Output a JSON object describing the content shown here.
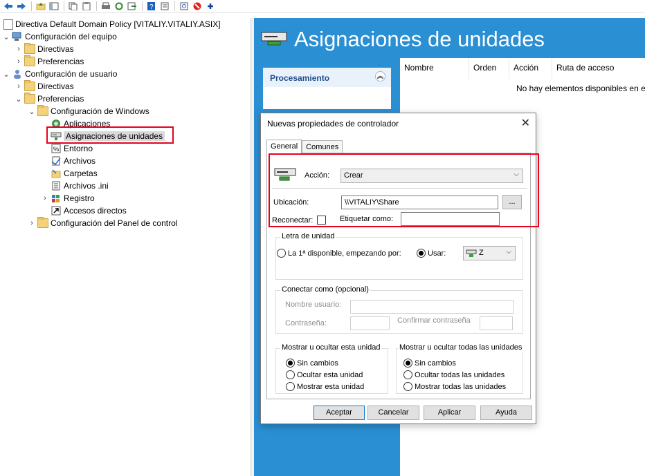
{
  "toolbar": {
    "icons": [
      "back-arrow-icon",
      "forward-arrow-icon",
      "up-folder-icon",
      "show-hide-tree-icon",
      "copy-icon",
      "paste-icon",
      "print-icon",
      "refresh-icon",
      "export-icon",
      "help-icon",
      "properties-icon",
      "stop-icon",
      "add-icon"
    ]
  },
  "tree": {
    "root": "Directiva Default Domain Policy [VITALIY.VITALIY.ASIX]",
    "computer_config": "Configuración del equipo",
    "c_policies": "Directivas",
    "c_prefs": "Preferencias",
    "user_config": "Configuración de usuario",
    "u_policies": "Directivas",
    "u_prefs": "Preferencias",
    "windows_config": "Configuración de Windows",
    "applications": "Aplicaciones",
    "drive_maps": "Asignaciones de unidades",
    "environment": "Entorno",
    "files": "Archivos",
    "folders": "Carpetas",
    "ini_files": "Archivos .ini",
    "registry": "Registro",
    "shortcuts": "Accesos directos",
    "control_panel": "Configuración del Panel de control"
  },
  "right": {
    "title": "Asignaciones de unidades",
    "processing": "Procesamiento",
    "columns": [
      "Nombre",
      "Orden",
      "Acción",
      "Ruta de acceso"
    ],
    "empty_message": "No hay elementos disponibles en es"
  },
  "dialog": {
    "title": "Nuevas propiedades de controlador",
    "close": "✕",
    "tabs": [
      "General",
      "Comunes"
    ],
    "action_label": "Acción:",
    "action_value": "Crear",
    "location_label": "Ubicación:",
    "location_value": "\\\\VITALIY\\Share",
    "browse_label": "...",
    "reconnect_label": "Reconectar:",
    "label_as": "Etiquetar como:",
    "drive_letter_group": "Letra de unidad",
    "first_available": "La 1ª disponible, empezando por:",
    "use_label": "Usar:",
    "use_value": "Z",
    "connect_as_group": "Conectar como (opcional)",
    "username": "Nombre usuario:",
    "password": "Contraseña:",
    "confirm_password": "Confirmar contraseña",
    "hide_show_drive_group": "Mostrar u ocultar esta unidad",
    "hide_show_all_group": "Mostrar u ocultar todas las unidades",
    "no_change": "Sin cambios",
    "hide_drive": "Ocultar esta unidad",
    "show_drive": "Mostrar esta unidad",
    "no_change_all": "Sin cambios",
    "hide_all": "Ocultar todas las unidades",
    "show_all": "Mostrar todas las unidades",
    "buttons": {
      "ok": "Aceptar",
      "cancel": "Cancelar",
      "apply": "Aplicar",
      "help": "Ayuda"
    }
  },
  "colors": {
    "banner": "#2b8fd3",
    "highlight": "#e8001c"
  }
}
